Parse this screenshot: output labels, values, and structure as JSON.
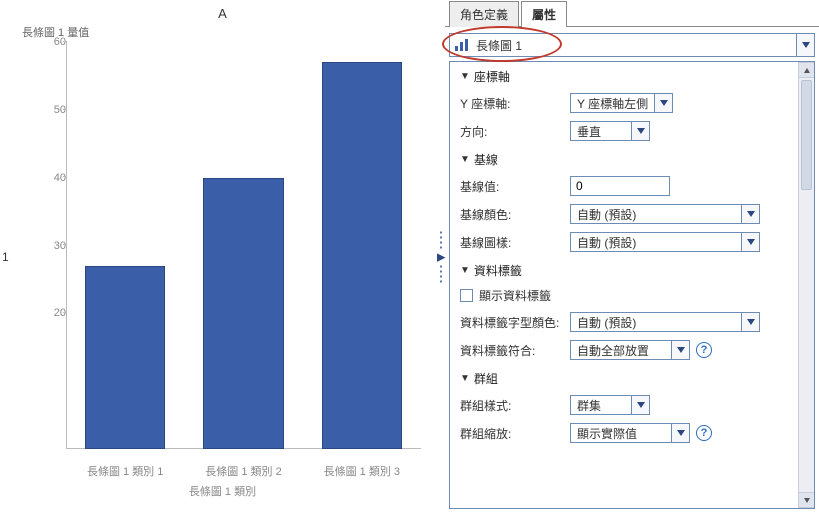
{
  "tabs": {
    "rolesDef": "角色定義",
    "properties": "屬性"
  },
  "selectRow": {
    "label": "長條圖 1"
  },
  "chart_data": {
    "type": "bar",
    "categories": [
      "長條圖 1 類別 1",
      "長條圖 1 類別 2",
      "長條圖 1 類別 3"
    ],
    "values": [
      27,
      40,
      57
    ],
    "title": "A",
    "xlabel": "長條圖 1 類別",
    "ylabel": "長條圖 1 量值",
    "ylim": [
      0,
      60
    ],
    "yticks": [
      20,
      30,
      40,
      50,
      60
    ]
  },
  "chart": {
    "rowIndex": "1"
  },
  "sections": {
    "axis": {
      "title": "座標軸",
      "yAxisLabel": "Y 座標軸:",
      "yAxisValue": "Y 座標軸左側",
      "directionLabel": "方向:",
      "directionValue": "垂直"
    },
    "baseline": {
      "title": "基線",
      "valueLabel": "基線值:",
      "valueValue": "0",
      "colorLabel": "基線顏色:",
      "colorValue": "自動 (預設)",
      "patternLabel": "基線圖樣:",
      "patternValue": "自動 (預設)"
    },
    "dataLabel": {
      "title": "資料標籤",
      "showLabel": "顯示資料標籤",
      "fontColorLabel": "資料標籤字型顏色:",
      "fontColorValue": "自動 (預設)",
      "fitLabel": "資料標籤符合:",
      "fitValue": "自動全部放置"
    },
    "group": {
      "title": "群組",
      "styleLabel": "群組樣式:",
      "styleValue": "群集",
      "scaleLabel": "群組縮放:",
      "scaleValue": "顯示實際值"
    }
  }
}
